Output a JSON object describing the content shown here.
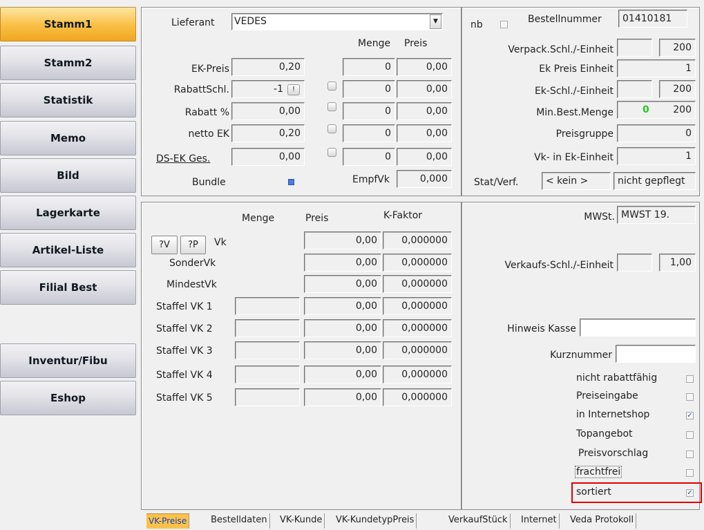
{
  "nav": {
    "stamm1": "Stamm1",
    "stamm2": "Stamm2",
    "statistik": "Statistik",
    "memo": "Memo",
    "bild": "Bild",
    "lagerkarte": "Lagerkarte",
    "artikel_liste": "Artikel-Liste",
    "filial_best": "Filial Best",
    "inventur": "Inventur/Fibu",
    "eshop": "Eshop"
  },
  "top": {
    "lieferant_label": "Lieferant",
    "lieferant_value": "VEDES",
    "menge_header": "Menge",
    "preis_header": "Preis",
    "ek_preis_label": "EK-Preis",
    "ek_preis": "0,20",
    "rabattschl_label": "RabattSchl.",
    "rabattschl": "-1",
    "rabattschl_btn": "!",
    "rabatt_label": "Rabatt %",
    "rabatt": "0,00",
    "netto_ek_label": "netto EK",
    "netto_ek": "0,20",
    "ds_ek_label": "DS-EK Ges.",
    "ds_ek": "0,00",
    "bundle_label": "Bundle",
    "staffel": [
      {
        "menge": "0",
        "preis": "0,00"
      },
      {
        "menge": "0",
        "preis": "0,00"
      },
      {
        "menge": "0",
        "preis": "0,00"
      },
      {
        "menge": "0",
        "preis": "0,00"
      },
      {
        "menge": "0",
        "preis": "0,00"
      }
    ],
    "empfvk_label": "EmpfVk",
    "empfvk": "0,000"
  },
  "right_top": {
    "nb_label": "nb",
    "bestellnummer_label": "Bestellnummer",
    "bestellnummer": "01410181",
    "verpack_label": "Verpack.Schl./-Einheit",
    "verpack": "200",
    "ek_preis_einheit_label": "Ek Preis Einheit",
    "ek_preis_einheit": "1",
    "ek_schl_label": "Ek-Schl./-Einheit",
    "ek_schl": "200",
    "min_best_label": "Min.Best.Menge",
    "min_best_green": "0",
    "min_best": "200",
    "preisgruppe_label": "Preisgruppe",
    "preisgruppe": "0",
    "vk_in_ek_label": "Vk- in Ek-Einheit",
    "vk_in_ek": "1",
    "stat_label": "Stat/Verf.",
    "stat_value": "< kein >",
    "stat_value2": "nicht gepflegt"
  },
  "vk": {
    "menge_header": "Menge",
    "preis_header": "Preis",
    "kfaktor_header": "K-Faktor",
    "btn_v": "?V",
    "btn_p": "?P",
    "rows": [
      {
        "label": "Vk",
        "menge": "",
        "preis": "0,00",
        "kfaktor": "0,000000"
      },
      {
        "label": "SonderVk",
        "menge": "",
        "preis": "0,00",
        "kfaktor": "0,000000"
      },
      {
        "label": "MindestVk",
        "menge": "",
        "preis": "0,00",
        "kfaktor": "0,000000"
      },
      {
        "label": "Staffel VK 1",
        "menge": "",
        "preis": "0,00",
        "kfaktor": "0,000000"
      },
      {
        "label": "Staffel VK 2",
        "menge": "",
        "preis": "0,00",
        "kfaktor": "0,000000"
      },
      {
        "label": "Staffel VK 3",
        "menge": "",
        "preis": "0,00",
        "kfaktor": "0,000000"
      },
      {
        "label": "Staffel VK 4",
        "menge": "",
        "preis": "0,00",
        "kfaktor": "0,000000"
      },
      {
        "label": "Staffel VK 5",
        "menge": "",
        "preis": "0,00",
        "kfaktor": "0,000000"
      }
    ]
  },
  "right_bottom": {
    "mwst_label": "MWSt.",
    "mwst": "MWST 19.",
    "vk_schl_label": "Verkaufs-Schl./-Einheit",
    "vk_schl": "1,00",
    "hinweis_label": "Hinweis Kasse",
    "hinweis": "",
    "kurznummer_label": "Kurznummer",
    "kurznummer": "",
    "checks": [
      {
        "label": "nicht rabattfähig",
        "checked": false
      },
      {
        "label": "Preiseingabe",
        "checked": false
      },
      {
        "label": "in Internetshop",
        "checked": true
      },
      {
        "label": "Topangebot",
        "checked": false
      },
      {
        "label": "Preisvorschlag",
        "checked": false
      },
      {
        "label": "frachtfrei",
        "checked": false
      },
      {
        "label": "sortiert",
        "checked": true
      }
    ]
  },
  "tabs": [
    "VK-Preise",
    "Bestelldaten",
    "VK-Kunde",
    "VK-KundetypPreis",
    "VerkaufStück",
    "Internet",
    "Veda Protokoll"
  ],
  "colors": {
    "active_nav": "#f9c24a",
    "highlight": "#e00000",
    "min_best_green": "#22cc22",
    "active_tab_text": "#1a3fbf"
  }
}
